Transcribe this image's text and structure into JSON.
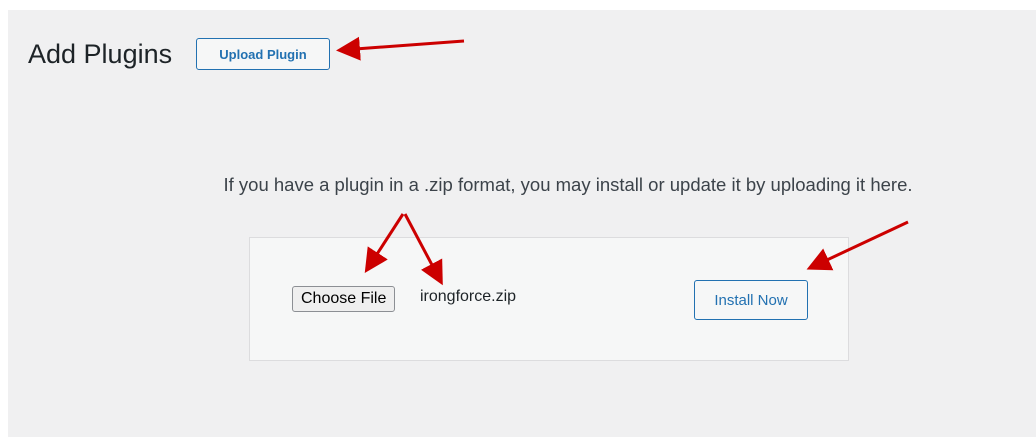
{
  "page": {
    "title": "Add Plugins",
    "upload_plugin_label": "Upload Plugin",
    "help_text": "If you have a plugin in a .zip format, you may install or update it by uploading it here."
  },
  "upload_form": {
    "choose_file_label": "Choose File",
    "selected_file": "irongforce.zip",
    "install_label": "Install Now"
  },
  "annotations": {
    "arrow_color": "#cc0000",
    "arrow_count": 4
  }
}
